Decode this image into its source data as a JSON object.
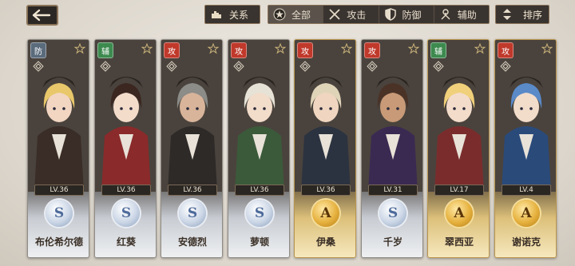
{
  "toolbar": {
    "relation_label": "关系",
    "filters": [
      {
        "label": "全部",
        "icon": "all-star-icon",
        "active": true
      },
      {
        "label": "攻击",
        "icon": "crossed-swords-icon",
        "active": false
      },
      {
        "label": "防御",
        "icon": "shield-icon",
        "active": false
      },
      {
        "label": "辅助",
        "icon": "support-icon",
        "active": false
      }
    ],
    "sort_label": "排序"
  },
  "colors": {
    "attack_badge": "#c0392b",
    "defense_badge": "#5a6b7c",
    "support_badge": "#3d8a4f"
  },
  "characters": [
    {
      "role": "防",
      "level": "LV.36",
      "rank": "S",
      "name": "布伦希尔德",
      "hair": "#e8c86a",
      "coat": "#3a2d27",
      "skin": "#f2d6c2"
    },
    {
      "role": "辅",
      "level": "LV.36",
      "rank": "S",
      "name": "红葵",
      "hair": "#3b2620",
      "coat": "#8a2a2a",
      "skin": "#f4dccb"
    },
    {
      "role": "攻",
      "level": "LV.36",
      "rank": "S",
      "name": "安德烈",
      "hair": "#8c8c88",
      "coat": "#2d2a28",
      "skin": "#d8b49a"
    },
    {
      "role": "攻",
      "level": "LV.36",
      "rank": "S",
      "name": "萝顿",
      "hair": "#e6e2d6",
      "coat": "#3b5a3a",
      "skin": "#f2dcca"
    },
    {
      "role": "攻",
      "level": "LV.36",
      "rank": "A",
      "name": "伊桑",
      "hair": "#e0d4b8",
      "coat": "#2c3340",
      "skin": "#f0d6c0"
    },
    {
      "role": "攻",
      "level": "LV.31",
      "rank": "S",
      "name": "千岁",
      "hair": "#4a3226",
      "coat": "#3a2a52",
      "skin": "#c89a78"
    },
    {
      "role": "辅",
      "level": "LV.17",
      "rank": "A",
      "name": "翠西亚",
      "hair": "#f0d07a",
      "coat": "#7a2c2c",
      "skin": "#f4dccb"
    },
    {
      "role": "攻",
      "level": "LV.4",
      "rank": "A",
      "name": "谢诺克",
      "hair": "#5a8ac8",
      "coat": "#2a4a7a",
      "skin": "#f2dcca"
    }
  ]
}
